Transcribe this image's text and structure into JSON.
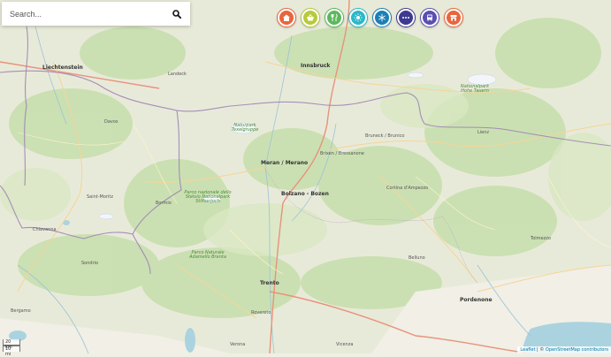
{
  "search": {
    "placeholder": "Search..."
  },
  "categories": [
    {
      "name": "accommodation",
      "color": "#e8663d"
    },
    {
      "name": "food-shop",
      "color": "#b8c93a"
    },
    {
      "name": "restaurant",
      "color": "#5cb85c"
    },
    {
      "name": "summer-activity",
      "color": "#2bb8c8"
    },
    {
      "name": "winter-activity",
      "color": "#1b7fb5"
    },
    {
      "name": "more",
      "color": "#3d3a8f"
    },
    {
      "name": "transport",
      "color": "#5a4fb0"
    },
    {
      "name": "shop",
      "color": "#e8663d"
    }
  ],
  "map": {
    "places": {
      "liechtenstein": "Liechtenstein",
      "davos": "Davos",
      "st_moritz": "Saint-Moritz",
      "bormio": "Bormio",
      "merano": "Meran / Merano",
      "bolzano": "Bolzano - Bozen",
      "brixen": "Brixen / Bressanone",
      "chiavenna": "Chiavenna",
      "sondrio": "Sondrio",
      "trento": "Trento",
      "rovereto": "Rovereto",
      "pordenone": "Pordenone",
      "belluno": "Belluno",
      "innsbruck": "Innsbruck",
      "brunico": "Bruneck / Brunico",
      "cortina": "Cortina d'Ampezzo",
      "landeck": "Landeck",
      "lienz": "Lienz",
      "vicenza": "Vicenza",
      "bergamo": "Bergamo",
      "verona": "Verona",
      "tolmezzo": "Tolmezzo"
    },
    "parks": {
      "stelvio": "Parco nazionale dello Stelvio Nationalpark Stilfserjoch",
      "adamello": "Parco Naturale Adamello Brenta",
      "hohe_tauern": "Nationalpark Hohe Tauern",
      "texel": "Naturpark Texelgruppe"
    }
  },
  "scale": {
    "km": "20 km",
    "mi": "10 mi"
  },
  "attribution": {
    "leaflet": "Leaflet",
    "sep": " | © ",
    "osm": "OpenStreetMap contributors"
  }
}
